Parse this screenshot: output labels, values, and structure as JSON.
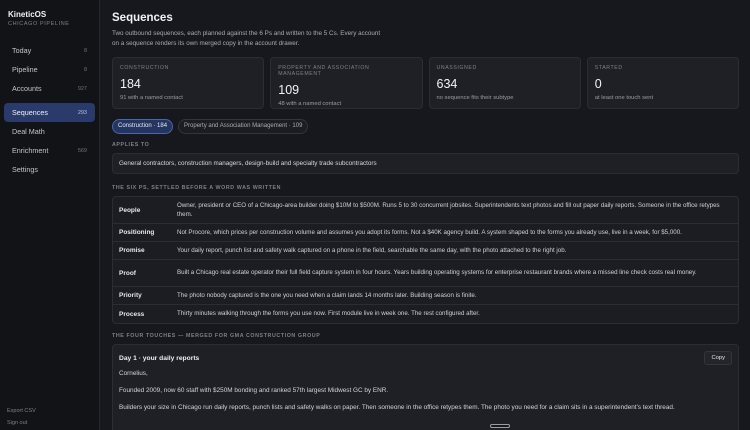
{
  "brand": {
    "title": "KineticOS",
    "subtitle": "CHICAGO PIPELINE"
  },
  "nav": {
    "items": [
      {
        "label": "Today",
        "count": "8"
      },
      {
        "label": "Pipeline",
        "count": "8"
      },
      {
        "label": "Accounts",
        "count": "927"
      },
      {
        "label": "Sequences",
        "count": "293"
      },
      {
        "label": "Deal Math",
        "count": ""
      },
      {
        "label": "Enrichment",
        "count": "569"
      },
      {
        "label": "Settings",
        "count": ""
      }
    ],
    "footer": {
      "export": "Export CSV",
      "signout": "Sign out"
    }
  },
  "page": {
    "title": "Sequences",
    "description": "Two outbound sequences, each planned against the 6 Ps and written to the 5 Cs. Every account on a sequence renders its own merged copy in the account drawer."
  },
  "stats": [
    {
      "label": "Construction",
      "value": "184",
      "sub": "91 with a named contact"
    },
    {
      "label": "Property and Association Management",
      "value": "109",
      "sub": "48 with a named contact"
    },
    {
      "label": "Unassigned",
      "value": "634",
      "sub": "no sequence fits their subtype"
    },
    {
      "label": "Started",
      "value": "0",
      "sub": "at least one touch sent"
    }
  ],
  "pills": [
    {
      "label": "Construction · 184",
      "active": true
    },
    {
      "label": "Property and Association Management · 109",
      "active": false
    }
  ],
  "applies": {
    "label": "Applies to",
    "text": "General contractors, construction managers, design-build and specialty trade subcontractors"
  },
  "six_ps": {
    "label": "The six Ps, settled before a word was written",
    "rows": [
      {
        "key": "People",
        "value": "Owner, president or CEO of a Chicago-area builder doing $10M to $500M. Runs 5 to 30 concurrent jobsites. Superintendents text photos and fill out paper daily reports. Someone in the office retypes them."
      },
      {
        "key": "Positioning",
        "value": "Not Procore, which prices per construction volume and assumes you adopt its forms. Not a $40K agency build. A system shaped to the forms you already use, live in a week, for $5,000."
      },
      {
        "key": "Promise",
        "value": "Your daily report, punch list and safety walk captured on a phone in the field, searchable the same day, with the photo attached to the right job."
      },
      {
        "key": "Proof",
        "value": "Built a Chicago real estate operator their full field capture system in four hours. Years building operating systems for enterprise restaurant brands where a missed line check costs real money."
      },
      {
        "key": "Priority",
        "value": "The photo nobody captured is the one you need when a claim lands 14 months later. Building season is finite."
      },
      {
        "key": "Process",
        "value": "Thirty minutes walking through the forms you use now. First module live in week one. The rest configured after."
      }
    ]
  },
  "touches": {
    "label": "The four touches — merged for GMA Construction Group",
    "day1": {
      "title": "Day 1 · your daily reports",
      "copy_label": "Copy",
      "lines": [
        "Cornelius,",
        "Founded 2009, now 60 staff with $250M bonding and ranked 57th largest Midwest GC by ENR.",
        "Builders your size in Chicago run daily reports, punch lists and safety walks on paper. Then someone in the office retypes them. The photo you need for a claim sits in a superintendent's text thread."
      ]
    }
  }
}
